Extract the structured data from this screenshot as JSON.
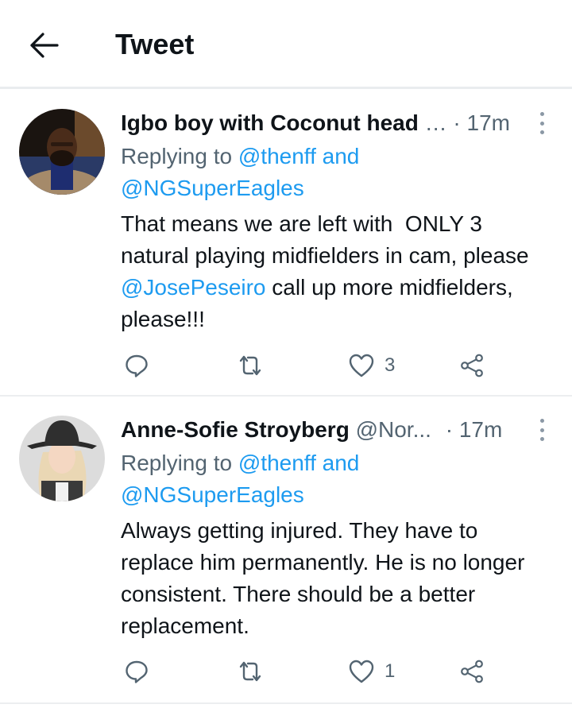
{
  "header": {
    "title": "Tweet",
    "back_icon": "arrow-left-icon"
  },
  "tweets": [
    {
      "author": "Igbo boy with Coconut head",
      "handle": "…",
      "separator": "·",
      "time": "17m",
      "reply_prefix": "Replying to ",
      "reply_user1": "@thenff",
      "reply_and": " and",
      "reply_user2": "@NGSuperEagles",
      "text_part1": "That means we are left with  ONLY 3 natural playing midfielders in cam, please ",
      "mention": "@JosePeseiro",
      "text_part2": " call up more midfielders, please!!!",
      "reply_count": "",
      "retweet_count": "",
      "like_count": "3"
    },
    {
      "author": "Anne-Sofie Stroyberg",
      "handle": "@Nor...",
      "separator": "·",
      "time": "17m",
      "reply_prefix": "Replying to ",
      "reply_user1": "@thenff",
      "reply_and": " and",
      "reply_user2": "@NGSuperEagles",
      "text": "Always getting injured. They have to replace him permanently. He is no longer consistent. There should be a better replacement.",
      "reply_count": "",
      "retweet_count": "",
      "like_count": "1"
    }
  ],
  "colors": {
    "link": "#1d9bf0",
    "muted": "#536471",
    "text": "#0f1419"
  }
}
